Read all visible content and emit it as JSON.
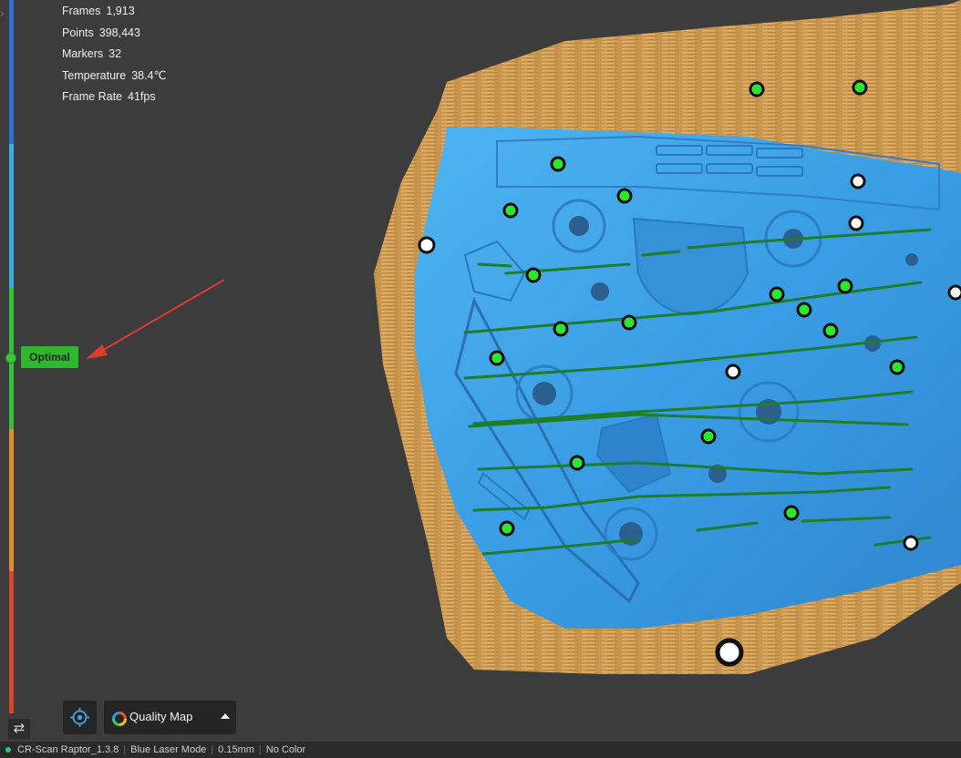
{
  "stats": [
    {
      "label": "Frames",
      "value": "1,913"
    },
    {
      "label": "Points",
      "value": "398,443"
    },
    {
      "label": "Markers",
      "value": "32"
    },
    {
      "label": "Temperature",
      "value": "38.4℃"
    },
    {
      "label": "Frame Rate",
      "value": "41fps"
    }
  ],
  "quality_indicator": {
    "label": "Optimal",
    "colors": {
      "blue": "#2f6fd1",
      "cyan": "#3aaee0",
      "green": "#35c035",
      "orange": "#e08b2a",
      "red": "#d9472b"
    }
  },
  "toolbar": {
    "target_icon": "target-icon",
    "view_mode_label": "Quality Map",
    "swap_icon": "swap-icon"
  },
  "status_bar": {
    "device": "CR-Scan Raptor_1.3.8",
    "mode": "Blue Laser Mode",
    "resolution": "0.15mm",
    "color": "No Color"
  },
  "scan_colors": {
    "surface": "#3fa4e8",
    "fringe": "#d9a65a",
    "stripe": "#1e7d2a",
    "marker_tracked": "#2ee62e",
    "marker_untracked": "#ffffff"
  }
}
